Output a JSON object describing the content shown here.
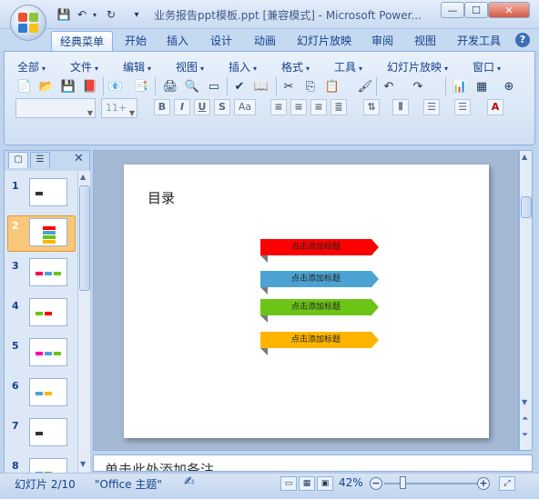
{
  "window": {
    "title": "业务报告ppt模板.ppt [兼容模式] - Microsoft Power...",
    "controls": [
      "—",
      "☐",
      "✕"
    ]
  },
  "quick_access": {
    "save": "💾",
    "undo": "↶",
    "redo": "↻",
    "customize": "▾"
  },
  "tabs": [
    "经典菜单",
    "开始",
    "插入",
    "设计",
    "动画",
    "幻灯片放映",
    "审阅",
    "视图",
    "开发工具"
  ],
  "help_label": "?",
  "menus": [
    "全部",
    "文件",
    "编辑",
    "视图",
    "插入",
    "格式",
    "工具",
    "幻灯片放映",
    "窗口"
  ],
  "font_combo": {
    "font": "",
    "size": "11+"
  },
  "format_buttons": [
    "B",
    "I",
    "U",
    "S",
    "Aa"
  ],
  "pane_close": "✕",
  "slides": [
    {
      "num": "1"
    },
    {
      "num": "2"
    },
    {
      "num": "3"
    },
    {
      "num": "4"
    },
    {
      "num": "5"
    },
    {
      "num": "6"
    },
    {
      "num": "7"
    },
    {
      "num": "8"
    }
  ],
  "current_slide": {
    "title": "目录",
    "items": [
      {
        "label": "点击添加标题",
        "color": "#ff0000"
      },
      {
        "label": "点击添加标题",
        "color": "#4ba3d3"
      },
      {
        "label": "点击添加标题",
        "color": "#6cc417"
      },
      {
        "label": "点击添加标题",
        "color": "#ffb400"
      }
    ]
  },
  "notes_placeholder": "单击此处添加备注",
  "status": {
    "slide_counter": "幻灯片 2/10",
    "theme": "\"Office 主题\"",
    "zoom": "42%",
    "zoom_level": 0.42
  }
}
